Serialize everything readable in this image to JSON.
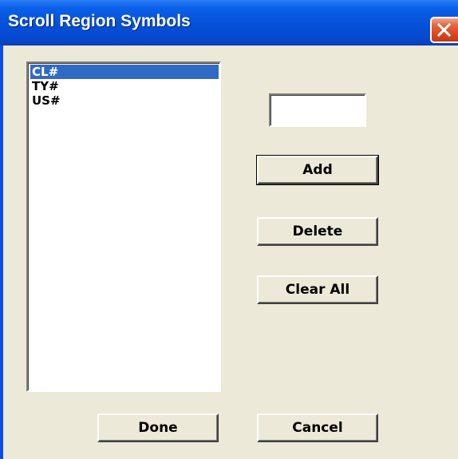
{
  "window": {
    "title": "Scroll Region Symbols"
  },
  "icons": {
    "close": "close-icon"
  },
  "symbol_list": {
    "items": [
      {
        "label": "CL#",
        "selected": true
      },
      {
        "label": "TY#",
        "selected": false
      },
      {
        "label": "US#",
        "selected": false
      }
    ]
  },
  "symbol_input": {
    "value": ""
  },
  "buttons": {
    "add": "Add",
    "delete": "Delete",
    "clear_all": "Clear All",
    "done": "Done",
    "cancel": "Cancel"
  },
  "colors": {
    "titlebar": "#0550d8",
    "close_button": "#d8461f",
    "dialog_face": "#ece9d8",
    "selection": "#316ac5"
  }
}
